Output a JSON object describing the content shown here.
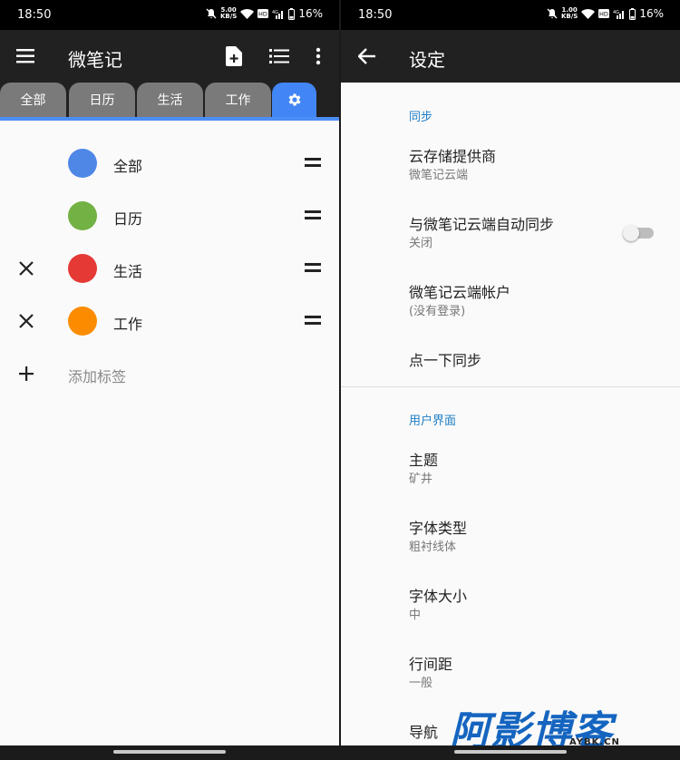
{
  "left": {
    "status": {
      "time": "18:50",
      "speed_value": "5.00",
      "speed_unit": "KB/S",
      "battery": "16%"
    },
    "appbar": {
      "title": "微笔记"
    },
    "tabs": [
      {
        "label": "全部"
      },
      {
        "label": "日历"
      },
      {
        "label": "生活"
      },
      {
        "label": "工作"
      }
    ],
    "active_tab_icon": "gear-icon",
    "labels": [
      {
        "name": "全部",
        "color": "#4e87e6",
        "deletable": false
      },
      {
        "name": "日历",
        "color": "#72b143",
        "deletable": false
      },
      {
        "name": "生活",
        "color": "#e53935",
        "deletable": true
      },
      {
        "name": "工作",
        "color": "#fb8c00",
        "deletable": true
      }
    ],
    "add_label": "添加标签"
  },
  "right": {
    "status": {
      "time": "18:50",
      "speed_value": "1.00",
      "speed_unit": "KB/S",
      "battery": "16%"
    },
    "appbar": {
      "title": "设定"
    },
    "sections": [
      {
        "header": "同步",
        "items": [
          {
            "title": "云存储提供商",
            "summary": "微笔记云端"
          },
          {
            "title": "与微笔记云端自动同步",
            "summary": "关闭",
            "switch": false
          },
          {
            "title": "微笔记云端帐户",
            "summary": "(没有登录)"
          },
          {
            "title": "点一下同步",
            "summary": ""
          }
        ]
      },
      {
        "header": "用户界面",
        "items": [
          {
            "title": "主题",
            "summary": "矿井"
          },
          {
            "title": "字体类型",
            "summary": "粗衬线体"
          },
          {
            "title": "字体大小",
            "summary": "中"
          },
          {
            "title": "行间距",
            "summary": "一般"
          },
          {
            "title": "导航",
            "summary": ""
          }
        ]
      }
    ],
    "watermark": {
      "main": "阿影博客",
      "sub": "AYBK.CN"
    }
  }
}
